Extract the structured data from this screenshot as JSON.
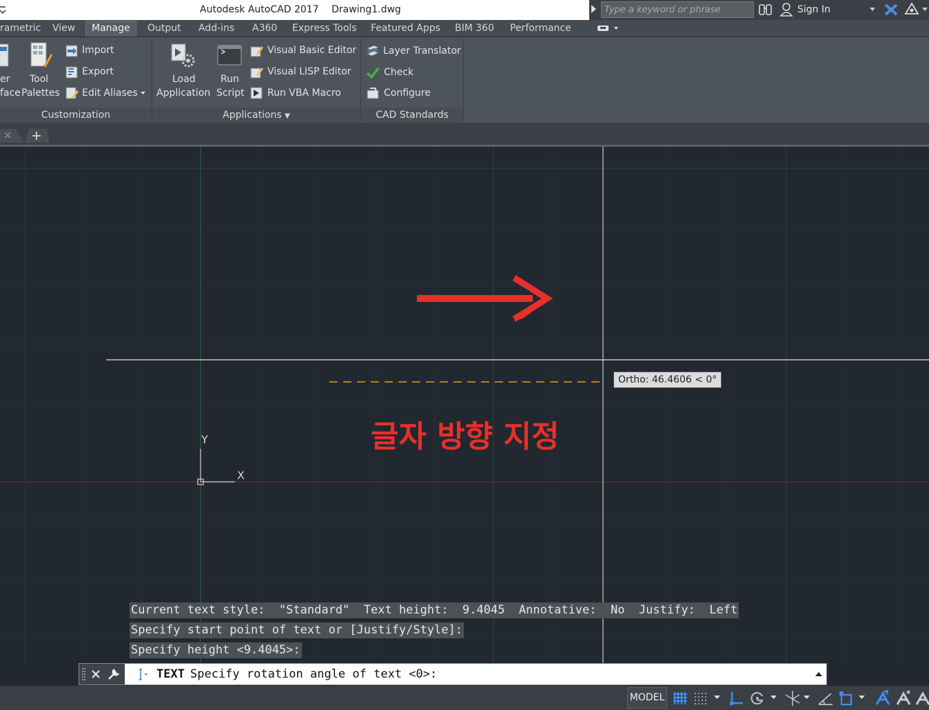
{
  "window": {
    "app_title": "Autodesk AutoCAD 2017",
    "drawing_name": "Drawing1.dwg",
    "search_placeholder": "Type a keyword or phrase",
    "sign_in": "Sign In"
  },
  "ribbon_tabs": [
    "rametric",
    "View",
    "Manage",
    "Output",
    "Add-ins",
    "A360",
    "Express Tools",
    "Featured Apps",
    "BIM 360",
    "Performance"
  ],
  "active_tab": "Manage",
  "ribbon": {
    "customization": {
      "title": "Customization",
      "user_interface_label_1": "er",
      "user_interface_label_2": "face",
      "tool_palettes_1": "Tool",
      "tool_palettes_2": "Palettes",
      "import": "Import",
      "export": "Export",
      "edit_aliases": "Edit Aliases"
    },
    "applications": {
      "title": "Applications",
      "load_1": "Load",
      "load_2": "Application",
      "run_1": "Run",
      "run_2": "Script",
      "vbe": "Visual Basic Editor",
      "vlisp": "Visual LISP Editor",
      "vba": "Run VBA Macro"
    },
    "cad_standards": {
      "title": "CAD Standards",
      "layer_translator": "Layer Translator",
      "check": "Check",
      "configure": "Configure"
    }
  },
  "canvas": {
    "tooltip": "Ortho: 46.4606 < 0°",
    "annotation": "글자 방향 지정",
    "ucs_x": "X",
    "ucs_y": "Y",
    "annotation_color": "#e8302a"
  },
  "command_history": [
    "Current text style:  \"Standard\"  Text height:  9.4045  Annotative:  No  Justify:  Left",
    "Specify start point of text or [Justify/Style]:",
    "Specify height <9.4045>:"
  ],
  "command_line": {
    "command": "TEXT",
    "prompt": "Specify rotation angle of text <0>:"
  },
  "status_bar": {
    "model": "MODEL"
  }
}
